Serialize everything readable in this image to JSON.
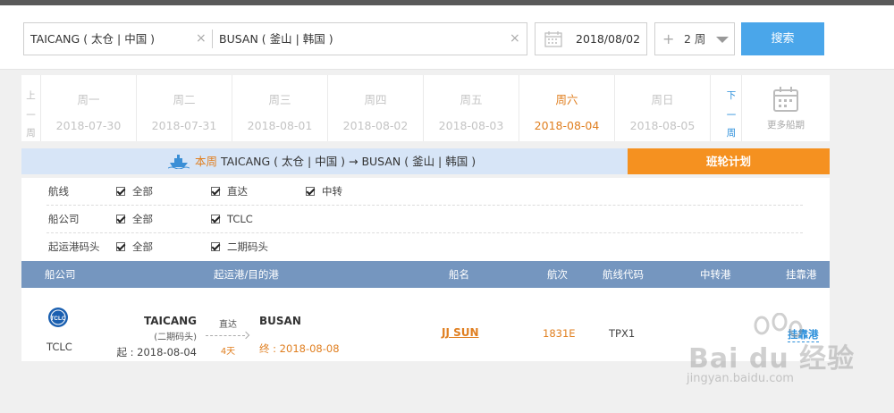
{
  "search": {
    "origin": "TAICANG ( 太仓 | 中国 )",
    "destination": "BUSAN ( 釜山 | 韩国 )",
    "clear_icon": "×",
    "date": "2018/08/02",
    "plus": "+",
    "weeks": "2 周",
    "button": "搜索"
  },
  "week_nav": {
    "prev": [
      "上",
      "一",
      "周"
    ],
    "next": [
      "下",
      "一",
      "周"
    ],
    "more_dates": "更多船期",
    "days": [
      {
        "weekday": "周一",
        "date": "2018-07-30"
      },
      {
        "weekday": "周二",
        "date": "2018-07-31"
      },
      {
        "weekday": "周三",
        "date": "2018-08-01"
      },
      {
        "weekday": "周四",
        "date": "2018-08-02"
      },
      {
        "weekday": "周五",
        "date": "2018-08-03"
      },
      {
        "weekday": "周六",
        "date": "2018-08-04"
      },
      {
        "weekday": "周日",
        "date": "2018-08-05"
      }
    ],
    "active_day": "周六"
  },
  "route_bar": {
    "highlight": "本周",
    "route": " TAICANG ( 太仓 | 中国 ) → BUSAN ( 釜山 | 韩国 )",
    "plan_button": "班轮计划"
  },
  "filters": [
    {
      "label": "航线",
      "options": [
        "全部",
        "直达",
        "中转"
      ]
    },
    {
      "label": "船公司",
      "options": [
        "全部",
        "TCLC"
      ]
    },
    {
      "label": "起运港码头",
      "options": [
        "全部",
        "二期码头"
      ]
    }
  ],
  "table": {
    "headers": [
      "船公司",
      "起运港/目的港",
      "船名",
      "航次",
      "航线代码",
      "中转港",
      "挂靠港"
    ],
    "rows": [
      {
        "logo_text": "TCLC",
        "carrier": "TCLC",
        "origin_port": "TAICANG",
        "origin_terminal": "(二期码头)",
        "departure": "起 : 2018-08-04",
        "route_type": "直达",
        "duration": "4天",
        "dest_port": "BUSAN",
        "arrival": "终 : 2018-08-08",
        "vessel": "JJ SUN",
        "voyage": "1831E",
        "service_code": "TPX1",
        "transshipment": "",
        "ports_link": "挂靠港"
      }
    ]
  },
  "watermark": {
    "text": "Bai du 经验",
    "url": "jingyan.baidu.com"
  },
  "colors": {
    "accent_orange": "#f59120",
    "active_text": "#e07f20",
    "search_blue": "#4aa6ea",
    "table_header": "#7596bf",
    "route_bar_bg": "#d7e5f7"
  }
}
